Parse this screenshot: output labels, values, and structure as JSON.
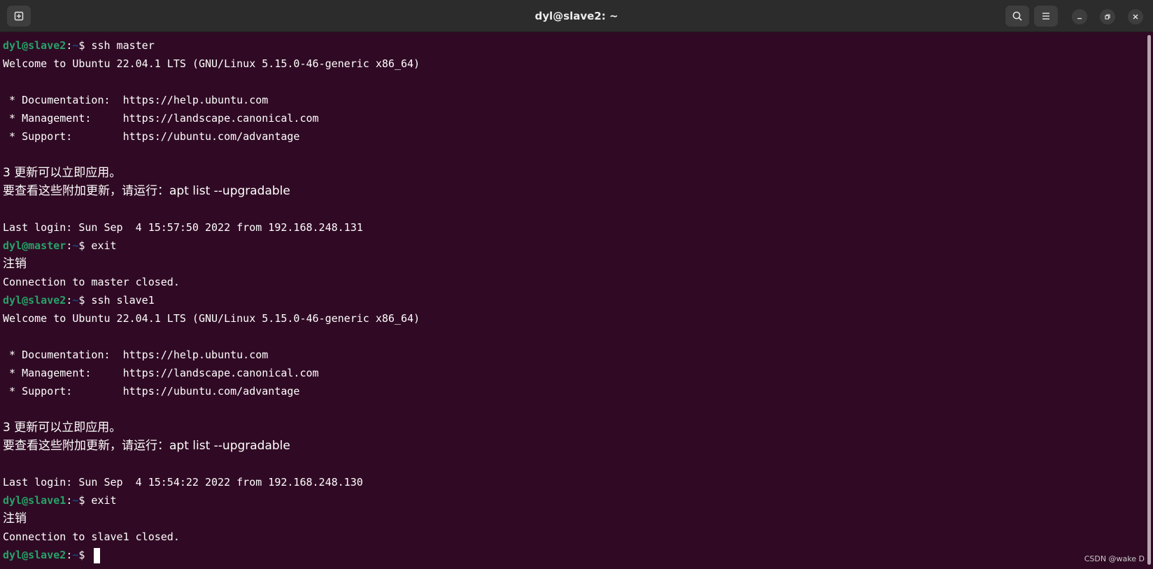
{
  "window": {
    "title": "dyl@slave2: ~"
  },
  "colors": {
    "background": "#300a24",
    "prompt_user": "#26a269",
    "prompt_path": "#12488b",
    "text": "#ffffff"
  },
  "titlebar": {
    "new_tab_icon": "new-tab-icon",
    "search_icon": "search-icon",
    "menu_icon": "hamburger-menu-icon",
    "minimize_icon": "minimize-icon",
    "maximize_icon": "maximize-icon",
    "close_icon": "close-icon"
  },
  "terminal": {
    "lines": [
      {
        "user": "dyl@slave2",
        "path": "~",
        "rest": "$ ssh master"
      },
      {
        "text": "Welcome to Ubuntu 22.04.1 LTS (GNU/Linux 5.15.0-46-generic x86_64)"
      },
      {
        "text": ""
      },
      {
        "text": " * Documentation:  https://help.ubuntu.com"
      },
      {
        "text": " * Management:     https://landscape.canonical.com"
      },
      {
        "text": " * Support:        https://ubuntu.com/advantage"
      },
      {
        "text": ""
      },
      {
        "text": "3 更新可以立即应用。",
        "cjk": true
      },
      {
        "text": "要查看这些附加更新，请运行：apt list --upgradable",
        "cjk": true
      },
      {
        "text": ""
      },
      {
        "text": "Last login: Sun Sep  4 15:57:50 2022 from 192.168.248.131"
      },
      {
        "user": "dyl@master",
        "path": "~",
        "rest": "$ exit"
      },
      {
        "text": "注销",
        "cjk": true
      },
      {
        "text": "Connection to master closed."
      },
      {
        "user": "dyl@slave2",
        "path": "~",
        "rest": "$ ssh slave1"
      },
      {
        "text": "Welcome to Ubuntu 22.04.1 LTS (GNU/Linux 5.15.0-46-generic x86_64)"
      },
      {
        "text": ""
      },
      {
        "text": " * Documentation:  https://help.ubuntu.com"
      },
      {
        "text": " * Management:     https://landscape.canonical.com"
      },
      {
        "text": " * Support:        https://ubuntu.com/advantage"
      },
      {
        "text": ""
      },
      {
        "text": "3 更新可以立即应用。",
        "cjk": true
      },
      {
        "text": "要查看这些附加更新，请运行：apt list --upgradable",
        "cjk": true
      },
      {
        "text": ""
      },
      {
        "text": "Last login: Sun Sep  4 15:54:22 2022 from 192.168.248.130"
      },
      {
        "user": "dyl@slave1",
        "path": "~",
        "rest": "$ exit"
      },
      {
        "text": "注销",
        "cjk": true
      },
      {
        "text": "Connection to slave1 closed."
      },
      {
        "user": "dyl@slave2",
        "path": "~",
        "rest": "$ ",
        "cursor": true
      }
    ]
  },
  "watermark": "CSDN @wake D"
}
